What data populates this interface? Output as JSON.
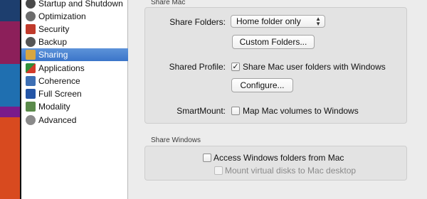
{
  "sidebar": {
    "items": [
      {
        "label": "Startup and Shutdown",
        "icon": "power-icon",
        "color": "#4a4a4a",
        "selected": false
      },
      {
        "label": "Optimization",
        "icon": "speedometer-icon",
        "color": "#6c6c6c",
        "selected": false
      },
      {
        "label": "Security",
        "icon": "lock-icon",
        "color": "#c03a2b",
        "selected": false
      },
      {
        "label": "Backup",
        "icon": "backup-icon",
        "color": "#555555",
        "selected": false
      },
      {
        "label": "Sharing",
        "icon": "shared-folder-icon",
        "color": "#d8a640",
        "selected": true
      },
      {
        "label": "Applications",
        "icon": "applications-icon",
        "color": "#2f8f3a",
        "selected": false
      },
      {
        "label": "Coherence",
        "icon": "coherence-icon",
        "color": "#3d6fb4",
        "selected": false
      },
      {
        "label": "Full Screen",
        "icon": "full-screen-icon",
        "color": "#2455a6",
        "selected": false
      },
      {
        "label": "Modality",
        "icon": "modality-icon",
        "color": "#5a8a4a",
        "selected": false
      },
      {
        "label": "Advanced",
        "icon": "gear-icon",
        "color": "#8a8a8a",
        "selected": false
      }
    ],
    "selected_color": "#3b75c9"
  },
  "share_mac": {
    "title": "Share Mac",
    "share_folders_label": "Share Folders:",
    "share_folders_value": "Home folder only",
    "custom_folders_button": "Custom Folders...",
    "shared_profile_label": "Shared Profile:",
    "shared_profile_checkbox": "Share Mac user folders with Windows",
    "shared_profile_checked": "✓",
    "configure_button": "Configure...",
    "smartmount_label": "SmartMount:",
    "smartmount_checkbox": "Map Mac volumes to Windows"
  },
  "share_windows": {
    "title": "Share Windows",
    "access_checkbox": "Access Windows folders from Mac",
    "mount_checkbox": "Mount virtual disks to Mac desktop"
  }
}
